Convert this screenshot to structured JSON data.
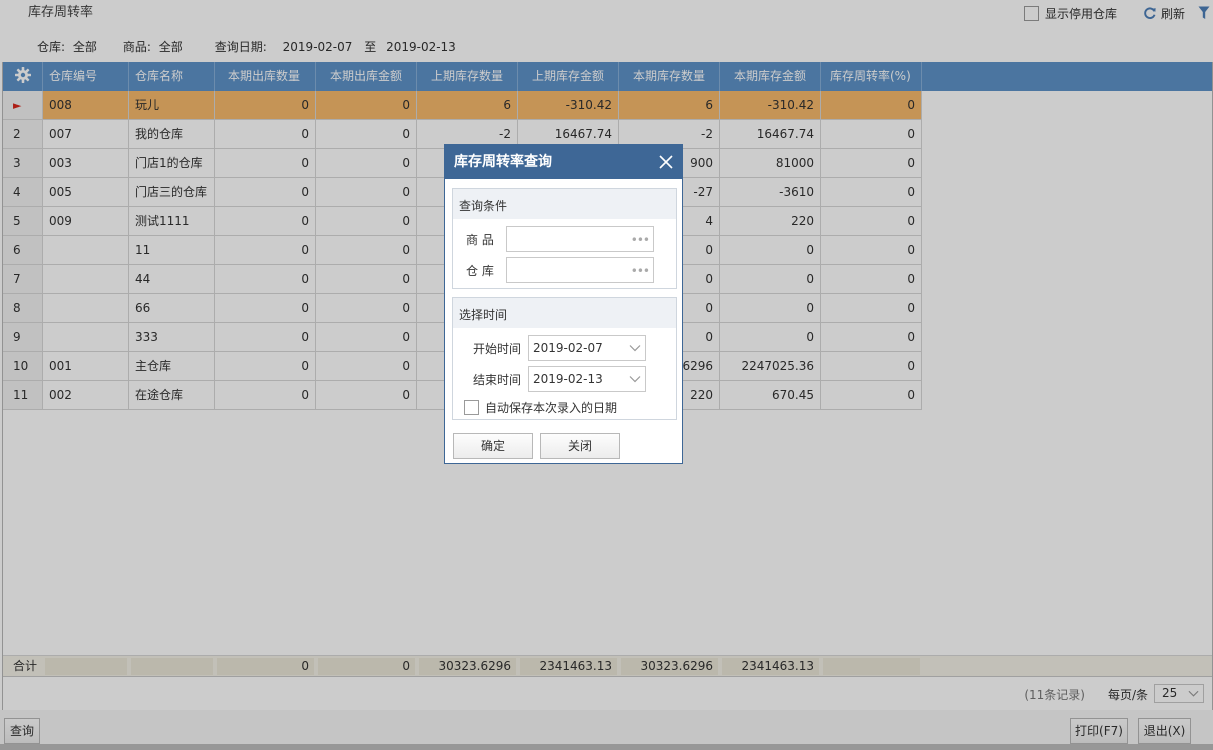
{
  "header": {
    "title": "库存周转率",
    "show_disabled_label": "显示停用仓库",
    "refresh_label": "刷新"
  },
  "criteria": {
    "warehouse_label": "仓库:",
    "warehouse_value": "全部",
    "product_label": "商品:",
    "product_value": "全部",
    "date_label": "查询日期:",
    "date_from": "2019-02-07",
    "date_sep": "至",
    "date_to": "2019-02-13"
  },
  "table": {
    "columns": [
      "仓库编号",
      "仓库名称",
      "本期出库数量",
      "本期出库金额",
      "上期库存数量",
      "上期库存金额",
      "本期库存数量",
      "本期库存金额",
      "库存周转率(%)"
    ],
    "rows": [
      {
        "n": "",
        "code": "008",
        "name": "玩儿",
        "out_qty": "0",
        "out_amt": "0",
        "prev_qty": "6",
        "prev_amt": "-310.42",
        "cur_qty": "6",
        "cur_amt": "-310.42",
        "rate": "0"
      },
      {
        "n": "2",
        "code": "007",
        "name": "我的仓库",
        "out_qty": "0",
        "out_amt": "0",
        "prev_qty": "-2",
        "prev_amt": "16467.74",
        "cur_qty": "-2",
        "cur_amt": "16467.74",
        "rate": "0"
      },
      {
        "n": "3",
        "code": "003",
        "name": "门店1的仓库",
        "out_qty": "0",
        "out_amt": "0",
        "prev_qty": "",
        "prev_amt": "",
        "cur_qty": "900",
        "cur_amt": "81000",
        "rate": "0"
      },
      {
        "n": "4",
        "code": "005",
        "name": "门店三的仓库",
        "out_qty": "0",
        "out_amt": "0",
        "prev_qty": "",
        "prev_amt": "",
        "cur_qty": "-27",
        "cur_amt": "-3610",
        "rate": "0"
      },
      {
        "n": "5",
        "code": "009",
        "name": "测试1111",
        "out_qty": "0",
        "out_amt": "0",
        "prev_qty": "",
        "prev_amt": "",
        "cur_qty": "4",
        "cur_amt": "220",
        "rate": "0"
      },
      {
        "n": "6",
        "code": "",
        "name": "11",
        "out_qty": "0",
        "out_amt": "0",
        "prev_qty": "",
        "prev_amt": "",
        "cur_qty": "0",
        "cur_amt": "0",
        "rate": "0"
      },
      {
        "n": "7",
        "code": "",
        "name": "44",
        "out_qty": "0",
        "out_amt": "0",
        "prev_qty": "",
        "prev_amt": "",
        "cur_qty": "0",
        "cur_amt": "0",
        "rate": "0"
      },
      {
        "n": "8",
        "code": "",
        "name": "66",
        "out_qty": "0",
        "out_amt": "0",
        "prev_qty": "",
        "prev_amt": "",
        "cur_qty": "0",
        "cur_amt": "0",
        "rate": "0"
      },
      {
        "n": "9",
        "code": "",
        "name": "333",
        "out_qty": "0",
        "out_amt": "0",
        "prev_qty": "",
        "prev_amt": "",
        "cur_qty": "0",
        "cur_amt": "0",
        "rate": "0"
      },
      {
        "n": "10",
        "code": "001",
        "name": "主仓库",
        "out_qty": "0",
        "out_amt": "0",
        "prev_qty": "",
        "prev_amt": "",
        "cur_qty": ".6296",
        "cur_amt": "2247025.36",
        "rate": "0"
      },
      {
        "n": "11",
        "code": "002",
        "name": "在途仓库",
        "out_qty": "0",
        "out_amt": "0",
        "prev_qty": "",
        "prev_amt": "",
        "cur_qty": "220",
        "cur_amt": "670.45",
        "rate": "0"
      }
    ],
    "totals": {
      "label": "合计",
      "out_qty": "0",
      "out_amt": "0",
      "prev_qty": "30323.6296",
      "prev_amt": "2341463.13",
      "cur_qty": "30323.6296",
      "cur_amt": "2341463.13"
    }
  },
  "pager": {
    "records": "(11条记录)",
    "per_page_label": "每页/条",
    "per_page_value": "25"
  },
  "bottom": {
    "query_label": "查询",
    "print_label": "打印(F7)",
    "exit_label": "退出(X)"
  },
  "dialog": {
    "title": "库存周转率查询",
    "conditions_title": "查询条件",
    "product_label": "商 品",
    "warehouse_label": "仓 库",
    "time_title": "选择时间",
    "start_label": "开始时间",
    "start_value": "2019-02-07",
    "end_label": "结束时间",
    "end_value": "2019-02-13",
    "autosave_label": "自动保存本次录入的日期",
    "ok_label": "确定",
    "close_label": "关闭"
  },
  "colors": {
    "header_bg": "#5e93c8",
    "selected_row": "#f7b96c",
    "dialog_title_bg": "#3e6796",
    "row_marker": "#d9261c"
  }
}
